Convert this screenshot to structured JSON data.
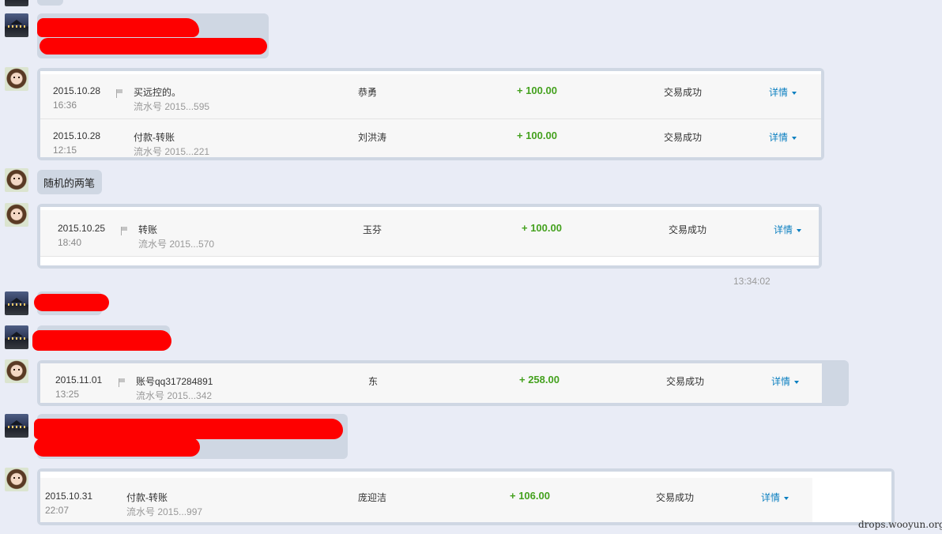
{
  "messages": {
    "m3": {
      "text": "随机的两笔"
    }
  },
  "timestamp": "13:34:02",
  "watermark": "drops.wooyun.org",
  "transactions": [
    {
      "date": "2015.10.28",
      "time": "16:36",
      "desc": "买远控的。",
      "serial": "流水号 2015...595",
      "party": "恭勇",
      "amount": "+ 100.00",
      "status": "交易成功",
      "detail": "详情"
    },
    {
      "date": "2015.10.28",
      "time": "12:15",
      "desc": "付款-转账",
      "serial": "流水号 2015...221",
      "party": "刘洪涛",
      "amount": "+ 100.00",
      "status": "交易成功",
      "detail": "详情"
    },
    {
      "date": "2015.10.25",
      "time": "18:40",
      "desc": "转账",
      "serial": "流水号 2015...570",
      "party": "玉芬",
      "amount": "+ 100.00",
      "status": "交易成功",
      "detail": "详情"
    },
    {
      "date": "2015.11.01",
      "time": "13:25",
      "desc": "账号qq317284891",
      "serial": "流水号 2015...342",
      "party": "东",
      "amount": "+ 258.00",
      "status": "交易成功",
      "detail": "详情"
    },
    {
      "date": "2015.10.31",
      "time": "22:07",
      "desc": "付款-转账",
      "serial": "流水号 2015...997",
      "party": "庞迎洁",
      "amount": "+ 106.00",
      "status": "交易成功",
      "detail": "详情"
    }
  ],
  "colors": {
    "amount": "#44a11e",
    "link": "#0b7fc0",
    "redaction": "#fe0000",
    "bubble": "#cfd7e3"
  },
  "icons": {
    "flag": "flag-icon",
    "caret": "caret-down-icon"
  }
}
